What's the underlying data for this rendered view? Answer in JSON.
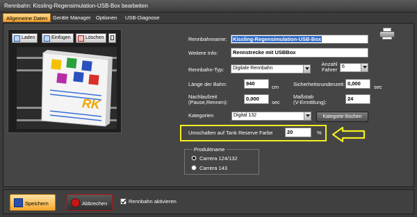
{
  "window": {
    "title": "Rennbahn: Kissling-Regensimulation-USB-Box bearbeiten"
  },
  "tabs": [
    {
      "label": "Allgemeine Daten",
      "active": true
    },
    {
      "label": "Geräte Manager",
      "active": false
    },
    {
      "label": "Optionen",
      "active": false
    },
    {
      "label": "USB-Diagnose",
      "active": false
    }
  ],
  "image_toolbar": {
    "load": "Laden",
    "paste": "Einfügen",
    "delete": "Löschen"
  },
  "image_logo": "RK",
  "form": {
    "name_label": "Rennbahnname:",
    "name_value": "Kissling-Regensimulation-USB-Box",
    "info_label": "Weitere Info:",
    "info_value": "Rennstrecke mit USBBox",
    "type_label": "Rennbahn-Typ:",
    "type_value": "Digitale Rennbahn",
    "drivers_label": "Anzahl Fahrer",
    "drivers_value": "6",
    "length_label": "Länge der Bahn:",
    "length_value": "940",
    "length_unit": "cm",
    "safety_label": "Sicherheitsrundenzeit:",
    "safety_value": "0,000",
    "safety_unit": "sec",
    "afterrun_label_1": "Nachlaufzeit",
    "afterrun_label_2": "(Pause,Rennen):",
    "afterrun_value": "0,000",
    "afterrun_unit": "sec",
    "scale_label_1": "Maßstab",
    "scale_label_2": "(V-Ermittlung):",
    "scale_value": "24",
    "category_label": "Kategorien",
    "category_value": "Digital 132",
    "category_delete": "Kategorie löschen",
    "reserve_label": "Umschalten auf Tank Reserve Farbe",
    "reserve_value": "20",
    "reserve_unit": "%"
  },
  "product": {
    "title": "Produktname",
    "options": [
      {
        "label": "Carrera 124/132",
        "selected": true
      },
      {
        "label": "Carrera 143",
        "selected": false
      }
    ]
  },
  "bottom": {
    "save": "Speichern",
    "cancel": "Abbrechen",
    "activate": "Rennbahn aktivieren",
    "activate_checked": true
  },
  "colors": {
    "accent_orange": "#f5a830",
    "highlight_yellow": "#f5f01e",
    "selection_blue": "#316ac5",
    "cancel_red": "#b01515"
  }
}
